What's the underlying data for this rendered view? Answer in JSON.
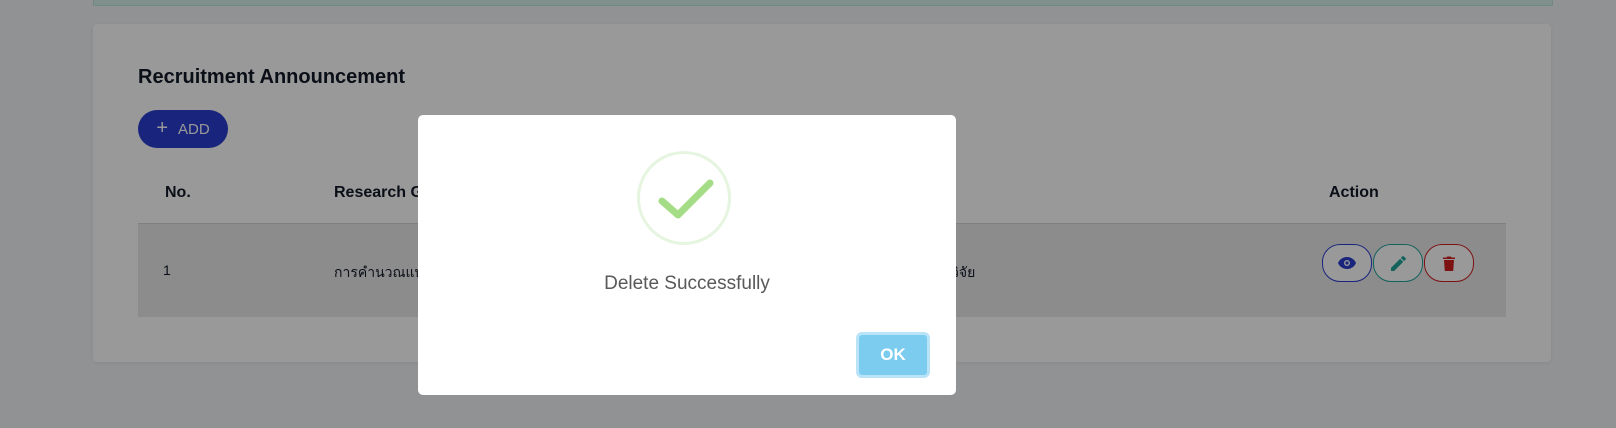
{
  "page": {
    "title": "Recruitment Announcement",
    "add_button": {
      "icon": "plus-icon",
      "label": "ADD"
    }
  },
  "table": {
    "columns": [
      "No.",
      "Research G",
      "Action"
    ],
    "rows": [
      {
        "no": "1",
        "research": "การคำนวณแบ",
        "extra": "นักวิจัย"
      }
    ],
    "actions": [
      {
        "icon": "eye-icon",
        "color": "#2a3fcf"
      },
      {
        "icon": "pencil-icon",
        "color": "#20a39a"
      },
      {
        "icon": "trash-icon",
        "color": "#d11f1f"
      }
    ]
  },
  "dialog": {
    "icon": "checkmark-icon",
    "message": "Delete Successfully",
    "ok_label": "OK"
  },
  "colors": {
    "primary": "#2a3fcf",
    "success": "#a5dc86",
    "ok_button": "#7cccf0"
  }
}
